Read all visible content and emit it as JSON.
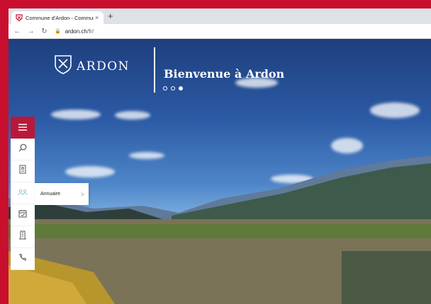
{
  "browser": {
    "tab_title": "Commune d'Ardon - Commune",
    "tab_close": "×",
    "new_tab": "+",
    "url_host": "ardon.ch",
    "url_path": "/fr/"
  },
  "site": {
    "logo_text": "ARDON",
    "hero_title": "Bienvenue à Ardon",
    "slides_total": 3,
    "slide_active": 3
  },
  "toolbar": {
    "items": [
      {
        "icon": "menu-icon"
      },
      {
        "icon": "search-icon"
      },
      {
        "icon": "id-card-icon"
      },
      {
        "icon": "group-icon",
        "label": "Annuaire"
      },
      {
        "icon": "calendar-icon"
      },
      {
        "icon": "building-icon"
      },
      {
        "icon": "phone-icon"
      }
    ],
    "flyout_label": "Annuaire",
    "flyout_chevron": ">"
  },
  "colors": {
    "brand": "#c8102e",
    "menu_button": "#b8193a"
  }
}
